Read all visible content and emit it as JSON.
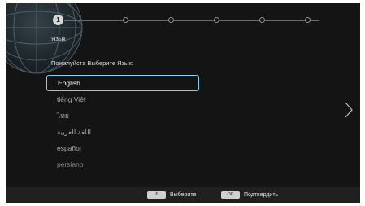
{
  "setup": {
    "active_step": "1",
    "step_title": "Язык",
    "prompt": "Пожалуйста Выберите Язык:"
  },
  "languages": [
    {
      "label": "English",
      "selected": true
    },
    {
      "label": "tiếng Việt",
      "selected": false
    },
    {
      "label": "ไทย",
      "selected": false
    },
    {
      "label": "اللغة العربية",
      "selected": false
    },
    {
      "label": "español",
      "selected": false
    },
    {
      "label": "persiano",
      "selected": false
    }
  ],
  "footer": {
    "select_key": "⇕",
    "select_label": "Выберите",
    "ok_key": "OK",
    "ok_label": "Подтвердить"
  },
  "colors": {
    "background": "#141414",
    "selection_border": "#7fd0ec",
    "footer_bar": "#202020"
  },
  "icons": {
    "globe": "globe-icon",
    "next": "chevron-right-icon"
  }
}
